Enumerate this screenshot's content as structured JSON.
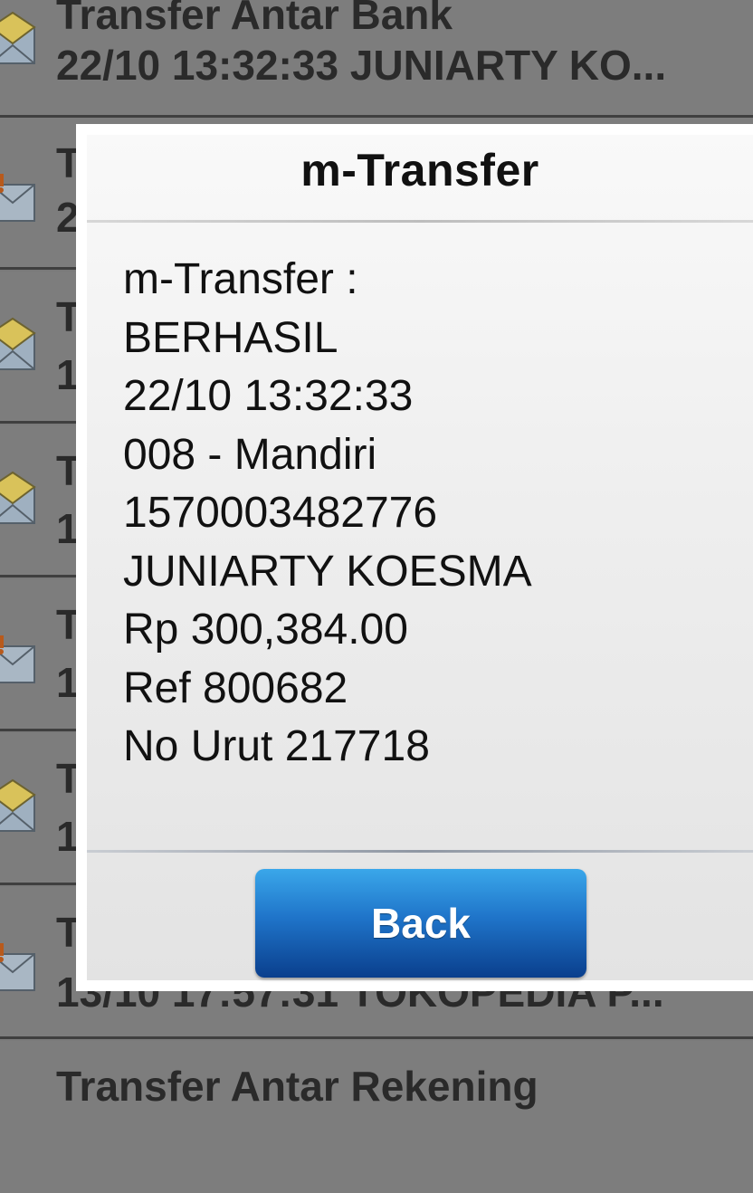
{
  "inbox": {
    "rows": [
      {
        "line1": "Transfer Antar Bank",
        "line2": "22/10 13:32:33 JUNIARTY KO...",
        "icon": "envelope-open-icon"
      },
      {
        "line1": "T",
        "line2": "2",
        "icon": "envelope-alert-icon"
      },
      {
        "line1": "T",
        "line2": "1",
        "icon": "envelope-open-icon"
      },
      {
        "line1": "T",
        "line2": "1",
        "icon": "envelope-open-icon"
      },
      {
        "line1": "T",
        "line2": "1",
        "icon": "envelope-alert-icon"
      },
      {
        "line1": "T",
        "line2": "1",
        "icon": "envelope-open-icon"
      },
      {
        "line1": "T",
        "line2": "13/10 17:57:31 TOKOPEDIA P...",
        "icon": "envelope-alert-icon"
      },
      {
        "line1": "Transfer Antar Rekening",
        "line2": "",
        "icon": ""
      }
    ]
  },
  "dialog": {
    "title": "m-Transfer",
    "lines": [
      "m-Transfer :",
      "BERHASIL",
      "22/10 13:32:33",
      "008 - Mandiri",
      "1570003482776",
      "JUNIARTY KOESMA",
      "Rp 300,384.00",
      "Ref 800682",
      "No Urut 217718"
    ],
    "back_label": "Back"
  },
  "colors": {
    "button_top": "#3aa7ea",
    "button_bottom": "#0a3f8d",
    "overlay": "#7a7a7a"
  }
}
